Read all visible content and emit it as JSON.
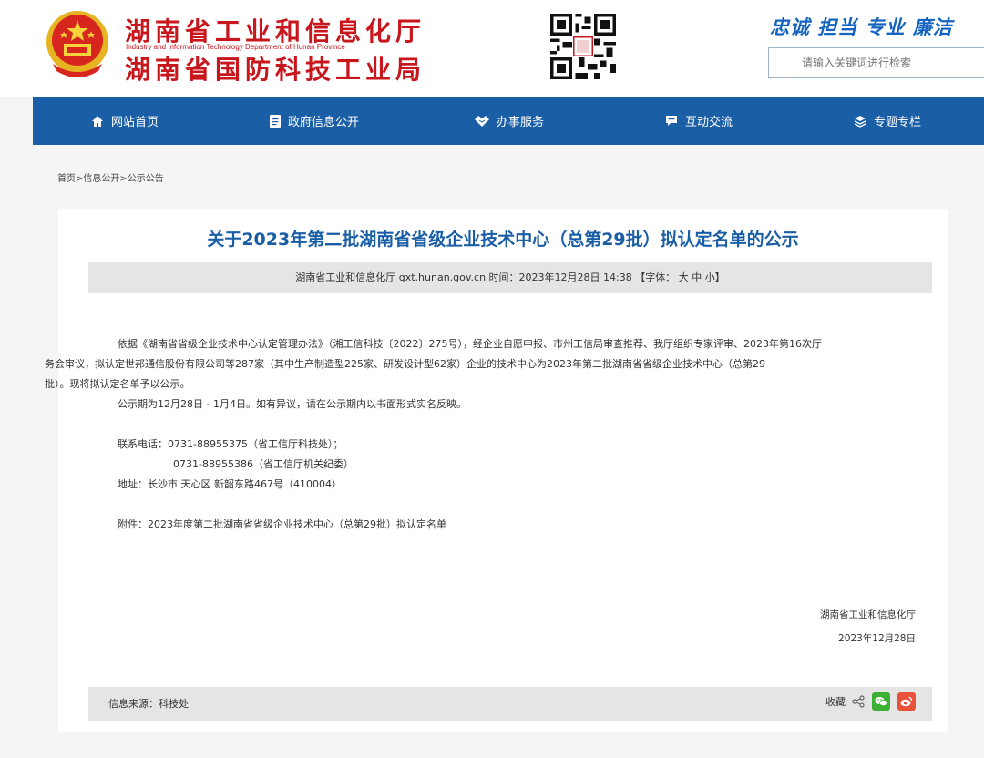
{
  "header": {
    "title_line1": "湖南省工业和信息化厅",
    "title_en": "Industry and Information Technology Department of Hunan Province",
    "title_line2": "湖南省国防科技工业局",
    "slogan": "忠诚 担当 专业 廉洁",
    "search_placeholder": "请输入关键词进行检索",
    "brand_color": "#c8161d",
    "accent_color": "#1a5ea6"
  },
  "nav": {
    "items": [
      {
        "label": "网站首页",
        "icon": "home-icon"
      },
      {
        "label": "政府信息公开",
        "icon": "document-icon"
      },
      {
        "label": "办事服务",
        "icon": "handshake-icon"
      },
      {
        "label": "互动交流",
        "icon": "chat-icon"
      },
      {
        "label": "专题专栏",
        "icon": "layers-icon"
      }
    ]
  },
  "breadcrumb": "首页>信息公开>公示公告",
  "article": {
    "title": "关于2023年第二批湖南省省级企业技术中心（总第29批）拟认定名单的公示",
    "meta_prefix": "湖南省工业和信息化厅 gxt.hunan.gov.cn   时间：2023年12月28日 14:38   【字体：",
    "font_large": "大",
    "font_medium": "中",
    "font_small": "小",
    "meta_suffix": "】",
    "para1_line1": "依据《湖南省省级企业技术中心认定管理办法》（湘工信科技〔2022〕275号），经企业自愿申报、市州工信局审查推荐、我厅组织专家评审、2023年第16次厅",
    "para1_line2": "务会审议，拟认定世邦通信股份有限公司等287家（其中生产制造型225家、研发设计型62家）企业的技术中心为2023年第二批湖南省省级企业技术中心（总第29",
    "para1_line3": "批）。现将拟认定名单予以公示。",
    "para2": "公示期为12月28日 - 1月4日。如有异议，请在公示期内以书面形式实名反映。",
    "contact1": "联系电话：0731-88955375（省工信厅科技处）；",
    "contact2": "0731-88955386（省工信厅机关纪委）",
    "address": "地址：长沙市 天心区 新韶东路467号（410004）",
    "attachment": "附件：2023年度第二批湖南省省级企业技术中心（总第29批）拟认定名单",
    "signature_org": "湖南省工业和信息化厅",
    "signature_date": "2023年12月28日"
  },
  "footer": {
    "source": "信息来源：科技处",
    "collect_label": "收藏"
  }
}
